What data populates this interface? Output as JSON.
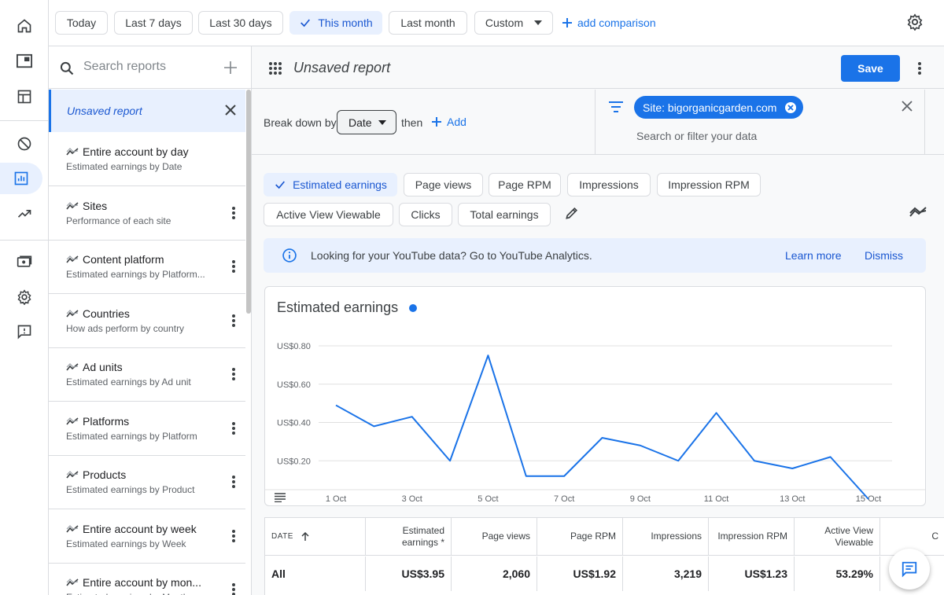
{
  "date_filters": {
    "today": "Today",
    "last7": "Last 7 days",
    "last30": "Last 30 days",
    "this_month": "This month",
    "last_month": "Last month",
    "custom": "Custom",
    "add_comparison": "add comparison",
    "selected": "This month"
  },
  "sidebar": {
    "search_placeholder": "Search reports",
    "current_report": "Unsaved report",
    "reports": [
      {
        "title": "Entire account by day",
        "subtitle": "Estimated earnings by Date"
      },
      {
        "title": "Sites",
        "subtitle": "Performance of each site"
      },
      {
        "title": "Content platform",
        "subtitle": "Estimated earnings by Platform..."
      },
      {
        "title": "Countries",
        "subtitle": "How ads perform by country"
      },
      {
        "title": "Ad units",
        "subtitle": "Estimated earnings by Ad unit"
      },
      {
        "title": "Platforms",
        "subtitle": "Estimated earnings by Platform"
      },
      {
        "title": "Products",
        "subtitle": "Estimated earnings by Product"
      },
      {
        "title": "Entire account by week",
        "subtitle": "Estimated earnings by Week"
      },
      {
        "title": "Entire account by mon...",
        "subtitle": "Estimated earnings by Month"
      }
    ]
  },
  "header": {
    "title": "Unsaved report",
    "save_label": "Save"
  },
  "breakdown": {
    "label": "Break down by",
    "value": "Date",
    "then": "then",
    "add": "Add"
  },
  "filter": {
    "chip": "Site: bigorganicgarden.com",
    "placeholder": "Search or filter your data"
  },
  "metrics": {
    "estimated_earnings": "Estimated earnings",
    "page_views": "Page views",
    "page_rpm": "Page RPM",
    "impressions": "Impressions",
    "impression_rpm": "Impression RPM",
    "active_view": "Active View Viewable",
    "clicks": "Clicks",
    "total_earnings": "Total earnings",
    "selected": "Estimated earnings"
  },
  "banner": {
    "text": "Looking for your YouTube data? Go to YouTube Analytics.",
    "learn_more": "Learn more",
    "dismiss": "Dismiss"
  },
  "chart_data": {
    "type": "line",
    "title": "Estimated earnings",
    "x": [
      "1 Oct",
      "2 Oct",
      "3 Oct",
      "4 Oct",
      "5 Oct",
      "6 Oct",
      "7 Oct",
      "8 Oct",
      "9 Oct",
      "10 Oct",
      "11 Oct",
      "12 Oct",
      "13 Oct",
      "14 Oct",
      "15 Oct"
    ],
    "x_tick_labels": [
      "1 Oct",
      "3 Oct",
      "5 Oct",
      "7 Oct",
      "9 Oct",
      "11 Oct",
      "13 Oct",
      "15 Oct"
    ],
    "y_tick_labels": [
      "US$0.80",
      "US$0.60",
      "US$0.40",
      "US$0.20"
    ],
    "y_ticks": [
      0.8,
      0.6,
      0.4,
      0.2
    ],
    "ylim": [
      0,
      0.8
    ],
    "series": [
      {
        "values": [
          0.49,
          0.38,
          0.43,
          0.2,
          0.75,
          0.12,
          0.12,
          0.32,
          0.28,
          0.2,
          0.45,
          0.2,
          0.16,
          0.22,
          0.0
        ]
      }
    ],
    "color": "#1a73e8",
    "grid": true
  },
  "table": {
    "headers": {
      "date": "DATE",
      "est_earnings": "Estimated earnings *",
      "page_views": "Page views",
      "page_rpm": "Page RPM",
      "impressions": "Impressions",
      "impression_rpm": "Impression RPM",
      "active_view": "Active View Viewable",
      "clicks_partial": "C"
    },
    "total_row": {
      "label": "All",
      "est_earnings": "US$3.95",
      "page_views": "2,060",
      "page_rpm": "US$1.92",
      "impressions": "3,219",
      "impression_rpm": "US$1.23",
      "active_view": "53.29%"
    }
  }
}
